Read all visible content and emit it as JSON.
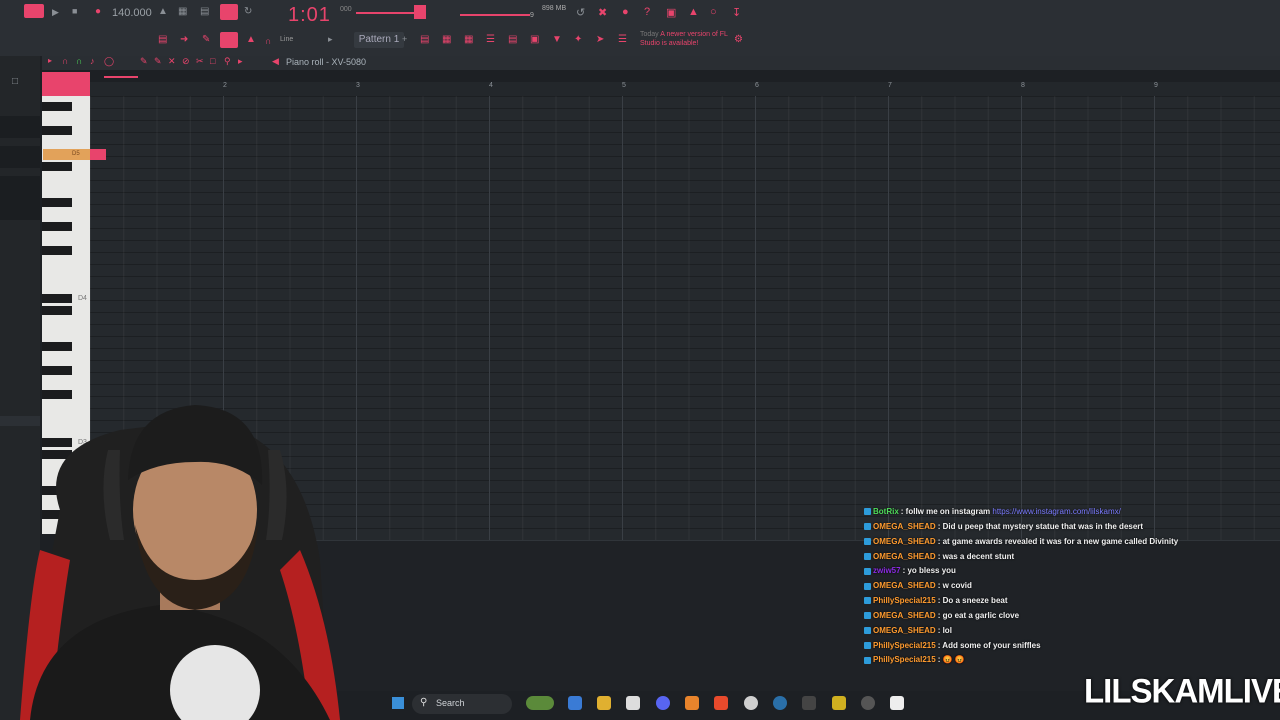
{
  "toolbar": {
    "tempo": "140.000",
    "time": "1:01",
    "time_sub": "000",
    "cpu_mb": "898 MB",
    "cpu_num": "9",
    "pattern": "Pattern 1",
    "snap": "Line",
    "news_today": "Today",
    "news_text": "A newer version of FL Studio is available!"
  },
  "piano_roll": {
    "title": "Piano roll - XV-5080",
    "bars": [
      "2",
      "3",
      "4",
      "5",
      "6",
      "7",
      "8",
      "9"
    ],
    "octave_labels": [
      "D4",
      "D3"
    ],
    "note_label": "D5"
  },
  "chat": [
    {
      "user": "BotRix",
      "color": "#4fdc5a",
      "text": "follw me on instagram",
      "link": "https://www.instagram.com/lilskamx/"
    },
    {
      "user": "OMEGA_SHEAD",
      "color": "#ff9b2f",
      "text": "Did u peep that mystery statue that was in the desert"
    },
    {
      "user": "OMEGA_SHEAD",
      "color": "#ff9b2f",
      "text": "at game awards revealed it was for a new game called Divinity"
    },
    {
      "user": "OMEGA_SHEAD",
      "color": "#ff9b2f",
      "text": "was a decent stunt"
    },
    {
      "user": "zwiw57",
      "color": "#8a2be2",
      "text": "yo bless you"
    },
    {
      "user": "OMEGA_SHEAD",
      "color": "#ff9b2f",
      "text": "w covid"
    },
    {
      "user": "PhillySpecial215",
      "color": "#ff9b2f",
      "text": "Do a sneeze beat"
    },
    {
      "user": "OMEGA_SHEAD",
      "color": "#ff9b2f",
      "text": "go eat a garlic clove"
    },
    {
      "user": "OMEGA_SHEAD",
      "color": "#ff9b2f",
      "text": "lol"
    },
    {
      "user": "PhillySpecial215",
      "color": "#ff9b2f",
      "text": "Add some of your sniffles"
    },
    {
      "user": "PhillySpecial215",
      "color": "#ff9b2f",
      "text": "😡 😡"
    }
  ],
  "taskbar": {
    "search_label": "Search"
  },
  "brand": "LILSKAMLIVE",
  "colors": {
    "accent": "#e8446c",
    "note": "#e2a25a",
    "background": "#1d2024"
  }
}
